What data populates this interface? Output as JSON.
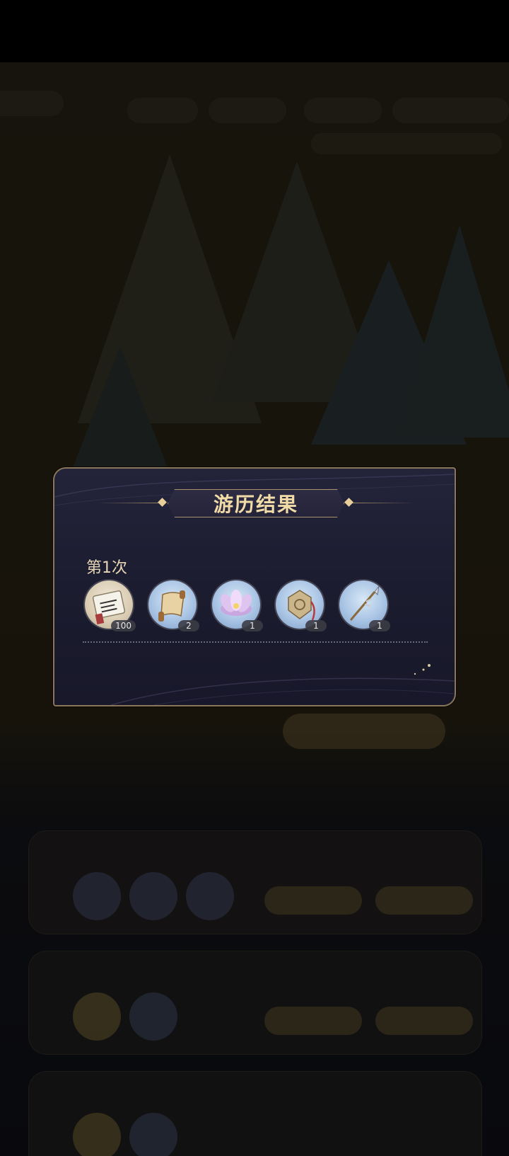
{
  "dialog": {
    "title": "游历结果",
    "round_label": "第1次",
    "rewards": [
      {
        "icon": "silk-scroll-icon",
        "count": "100"
      },
      {
        "icon": "paper-scroll-icon",
        "count": "2"
      },
      {
        "icon": "lotus-flower-icon",
        "count": "1"
      },
      {
        "icon": "jade-pendant-icon",
        "count": "1"
      },
      {
        "icon": "spear-icon",
        "count": "1"
      }
    ]
  },
  "colors": {
    "modal_bg": "#1b1b2e",
    "modal_border": "#8a7658",
    "title_text": "#f1dca8",
    "label_text": "#e6d6b6"
  }
}
